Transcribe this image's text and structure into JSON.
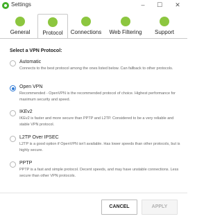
{
  "window": {
    "title": "Settings",
    "controls": {
      "minimize": "–",
      "maximize": "☐",
      "close": "✕"
    }
  },
  "tabs": [
    {
      "label": "General",
      "icon": "gear-icon"
    },
    {
      "label": "Protocol",
      "icon": "protocol-icon",
      "active": true
    },
    {
      "label": "Connections",
      "icon": "connections-icon"
    },
    {
      "label": "Web Filtering",
      "icon": "wifi-icon"
    },
    {
      "label": "Support",
      "icon": "support-icon"
    }
  ],
  "section_title": "Select a VPN Protocol:",
  "options": [
    {
      "title": "Automatic",
      "description": "Connects to the best protocol among the ones listed below. Can fallback to other protocols.",
      "selected": false
    },
    {
      "title": "Open VPN",
      "description": "Recommended - OpenVPN is the recommended protocol of choice. Highest performance for maximum security and speed.",
      "selected": true
    },
    {
      "title": "IKEv2",
      "description": "IKEv2 is faster and more secure than PPTP and L2TP. Considered to be a very reliable and stable VPN protocol.",
      "selected": false
    },
    {
      "title": "L2TP Over IPSEC",
      "description": "L2TP is a good option if OpenVPN isn't available. Has lower speeds than other protocols, but is highly secure.",
      "selected": false
    },
    {
      "title": "PPTP",
      "description": "PPTP is a fast and simple protocol. Decent speeds, and may have unstable connections. Less secure than other VPN protocols.",
      "selected": false
    }
  ],
  "buttons": {
    "cancel": "CANCEL",
    "apply": "APPLY"
  },
  "colors": {
    "accent": "#2f7ad5",
    "icon_green": "#8cc63f"
  }
}
